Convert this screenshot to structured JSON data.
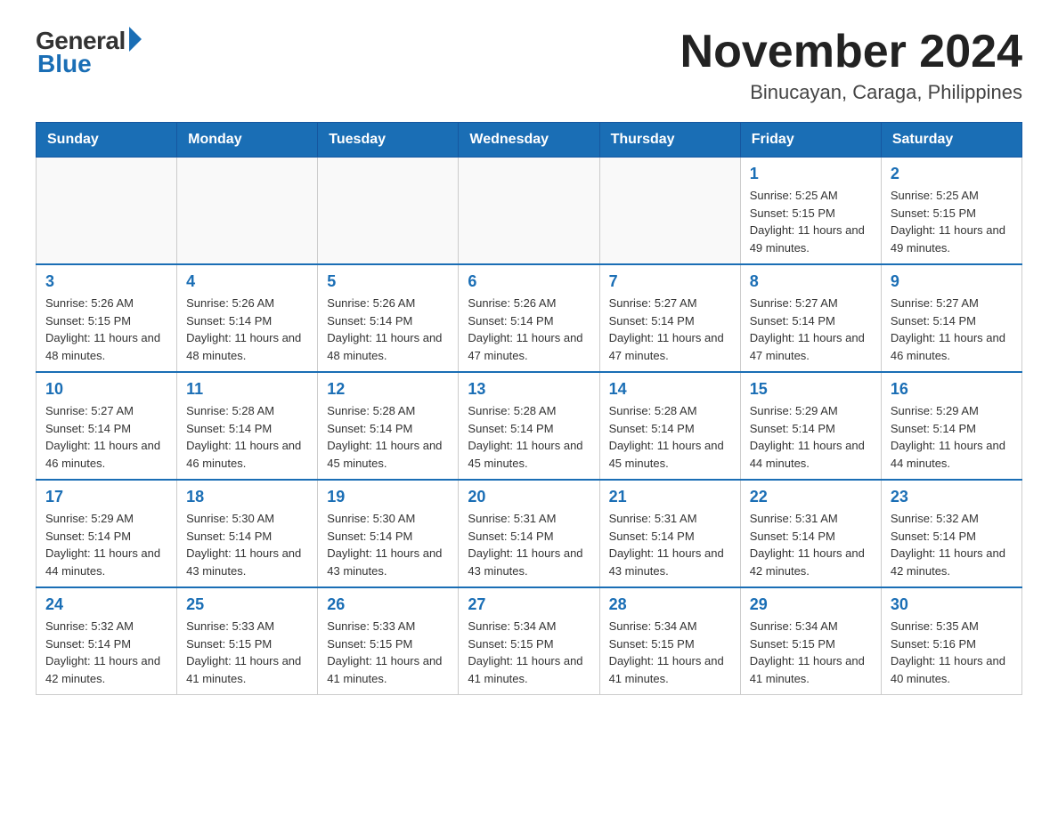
{
  "logo": {
    "general": "General",
    "blue": "Blue"
  },
  "title": {
    "month_year": "November 2024",
    "location": "Binucayan, Caraga, Philippines"
  },
  "headers": [
    "Sunday",
    "Monday",
    "Tuesday",
    "Wednesday",
    "Thursday",
    "Friday",
    "Saturday"
  ],
  "weeks": [
    [
      {
        "day": "",
        "sunrise": "",
        "sunset": "",
        "daylight": ""
      },
      {
        "day": "",
        "sunrise": "",
        "sunset": "",
        "daylight": ""
      },
      {
        "day": "",
        "sunrise": "",
        "sunset": "",
        "daylight": ""
      },
      {
        "day": "",
        "sunrise": "",
        "sunset": "",
        "daylight": ""
      },
      {
        "day": "",
        "sunrise": "",
        "sunset": "",
        "daylight": ""
      },
      {
        "day": "1",
        "sunrise": "Sunrise: 5:25 AM",
        "sunset": "Sunset: 5:15 PM",
        "daylight": "Daylight: 11 hours and 49 minutes."
      },
      {
        "day": "2",
        "sunrise": "Sunrise: 5:25 AM",
        "sunset": "Sunset: 5:15 PM",
        "daylight": "Daylight: 11 hours and 49 minutes."
      }
    ],
    [
      {
        "day": "3",
        "sunrise": "Sunrise: 5:26 AM",
        "sunset": "Sunset: 5:15 PM",
        "daylight": "Daylight: 11 hours and 48 minutes."
      },
      {
        "day": "4",
        "sunrise": "Sunrise: 5:26 AM",
        "sunset": "Sunset: 5:14 PM",
        "daylight": "Daylight: 11 hours and 48 minutes."
      },
      {
        "day": "5",
        "sunrise": "Sunrise: 5:26 AM",
        "sunset": "Sunset: 5:14 PM",
        "daylight": "Daylight: 11 hours and 48 minutes."
      },
      {
        "day": "6",
        "sunrise": "Sunrise: 5:26 AM",
        "sunset": "Sunset: 5:14 PM",
        "daylight": "Daylight: 11 hours and 47 minutes."
      },
      {
        "day": "7",
        "sunrise": "Sunrise: 5:27 AM",
        "sunset": "Sunset: 5:14 PM",
        "daylight": "Daylight: 11 hours and 47 minutes."
      },
      {
        "day": "8",
        "sunrise": "Sunrise: 5:27 AM",
        "sunset": "Sunset: 5:14 PM",
        "daylight": "Daylight: 11 hours and 47 minutes."
      },
      {
        "day": "9",
        "sunrise": "Sunrise: 5:27 AM",
        "sunset": "Sunset: 5:14 PM",
        "daylight": "Daylight: 11 hours and 46 minutes."
      }
    ],
    [
      {
        "day": "10",
        "sunrise": "Sunrise: 5:27 AM",
        "sunset": "Sunset: 5:14 PM",
        "daylight": "Daylight: 11 hours and 46 minutes."
      },
      {
        "day": "11",
        "sunrise": "Sunrise: 5:28 AM",
        "sunset": "Sunset: 5:14 PM",
        "daylight": "Daylight: 11 hours and 46 minutes."
      },
      {
        "day": "12",
        "sunrise": "Sunrise: 5:28 AM",
        "sunset": "Sunset: 5:14 PM",
        "daylight": "Daylight: 11 hours and 45 minutes."
      },
      {
        "day": "13",
        "sunrise": "Sunrise: 5:28 AM",
        "sunset": "Sunset: 5:14 PM",
        "daylight": "Daylight: 11 hours and 45 minutes."
      },
      {
        "day": "14",
        "sunrise": "Sunrise: 5:28 AM",
        "sunset": "Sunset: 5:14 PM",
        "daylight": "Daylight: 11 hours and 45 minutes."
      },
      {
        "day": "15",
        "sunrise": "Sunrise: 5:29 AM",
        "sunset": "Sunset: 5:14 PM",
        "daylight": "Daylight: 11 hours and 44 minutes."
      },
      {
        "day": "16",
        "sunrise": "Sunrise: 5:29 AM",
        "sunset": "Sunset: 5:14 PM",
        "daylight": "Daylight: 11 hours and 44 minutes."
      }
    ],
    [
      {
        "day": "17",
        "sunrise": "Sunrise: 5:29 AM",
        "sunset": "Sunset: 5:14 PM",
        "daylight": "Daylight: 11 hours and 44 minutes."
      },
      {
        "day": "18",
        "sunrise": "Sunrise: 5:30 AM",
        "sunset": "Sunset: 5:14 PM",
        "daylight": "Daylight: 11 hours and 43 minutes."
      },
      {
        "day": "19",
        "sunrise": "Sunrise: 5:30 AM",
        "sunset": "Sunset: 5:14 PM",
        "daylight": "Daylight: 11 hours and 43 minutes."
      },
      {
        "day": "20",
        "sunrise": "Sunrise: 5:31 AM",
        "sunset": "Sunset: 5:14 PM",
        "daylight": "Daylight: 11 hours and 43 minutes."
      },
      {
        "day": "21",
        "sunrise": "Sunrise: 5:31 AM",
        "sunset": "Sunset: 5:14 PM",
        "daylight": "Daylight: 11 hours and 43 minutes."
      },
      {
        "day": "22",
        "sunrise": "Sunrise: 5:31 AM",
        "sunset": "Sunset: 5:14 PM",
        "daylight": "Daylight: 11 hours and 42 minutes."
      },
      {
        "day": "23",
        "sunrise": "Sunrise: 5:32 AM",
        "sunset": "Sunset: 5:14 PM",
        "daylight": "Daylight: 11 hours and 42 minutes."
      }
    ],
    [
      {
        "day": "24",
        "sunrise": "Sunrise: 5:32 AM",
        "sunset": "Sunset: 5:14 PM",
        "daylight": "Daylight: 11 hours and 42 minutes."
      },
      {
        "day": "25",
        "sunrise": "Sunrise: 5:33 AM",
        "sunset": "Sunset: 5:15 PM",
        "daylight": "Daylight: 11 hours and 41 minutes."
      },
      {
        "day": "26",
        "sunrise": "Sunrise: 5:33 AM",
        "sunset": "Sunset: 5:15 PM",
        "daylight": "Daylight: 11 hours and 41 minutes."
      },
      {
        "day": "27",
        "sunrise": "Sunrise: 5:34 AM",
        "sunset": "Sunset: 5:15 PM",
        "daylight": "Daylight: 11 hours and 41 minutes."
      },
      {
        "day": "28",
        "sunrise": "Sunrise: 5:34 AM",
        "sunset": "Sunset: 5:15 PM",
        "daylight": "Daylight: 11 hours and 41 minutes."
      },
      {
        "day": "29",
        "sunrise": "Sunrise: 5:34 AM",
        "sunset": "Sunset: 5:15 PM",
        "daylight": "Daylight: 11 hours and 41 minutes."
      },
      {
        "day": "30",
        "sunrise": "Sunrise: 5:35 AM",
        "sunset": "Sunset: 5:16 PM",
        "daylight": "Daylight: 11 hours and 40 minutes."
      }
    ]
  ]
}
